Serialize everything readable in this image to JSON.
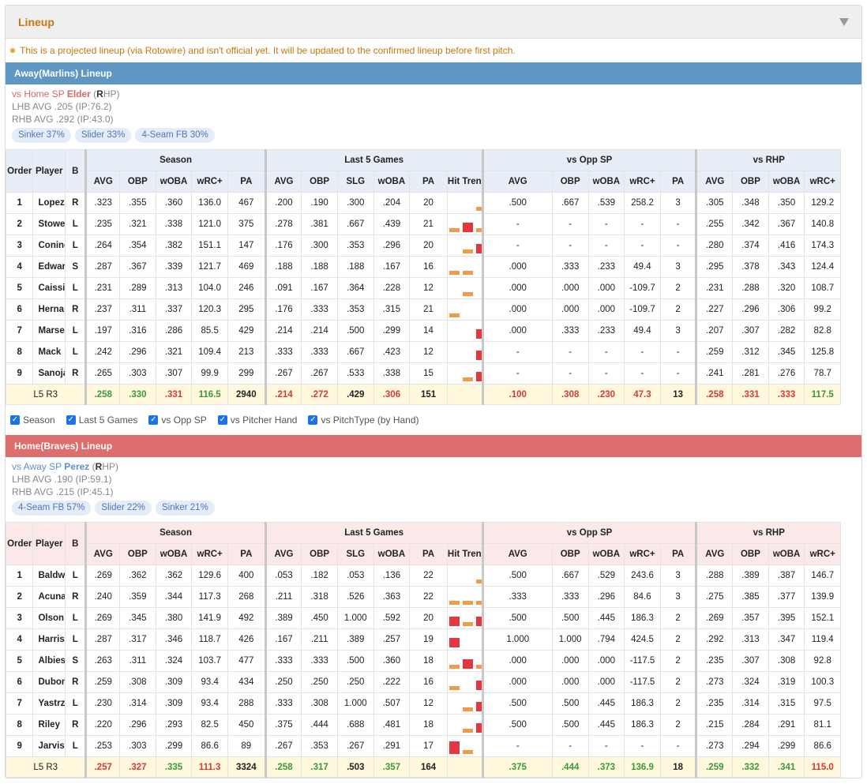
{
  "panel": {
    "title": "Lineup"
  },
  "note": "This is a projected lineup (via Rotowire) and isn't official yet. It will be updated to the confirmed lineup before first pitch.",
  "colors": {
    "away": "#5f97c4",
    "home": "#de6e6e",
    "green": "#3a9a3a",
    "red": "#d43a3a",
    "trend_orange": "#ee9c46",
    "trend_red": "#e3373f"
  },
  "headers": {
    "groups": [
      "Season",
      "Last 5 Games",
      "vs Opp SP",
      "vs RHP"
    ],
    "order": "Order",
    "player": "Player",
    "bats": "B",
    "season": [
      "AVG",
      "OBP",
      "wOBA",
      "wRC+",
      "PA"
    ],
    "last5": [
      "AVG",
      "OBP",
      "SLG",
      "wOBA",
      "PA",
      "Hit Trend"
    ],
    "opp": [
      "AVG",
      "OBP",
      "wOBA",
      "wRC+",
      "PA"
    ],
    "hand": [
      "AVG",
      "OBP",
      "wOBA",
      "wRC+"
    ]
  },
  "toggles": [
    "Season",
    "Last 5 Games",
    "vs Opp SP",
    "vs Pitcher Hand",
    "vs PitchType (by Hand)"
  ],
  "away": {
    "title": "Away(Marlins) Lineup",
    "sp": {
      "prefix": "vs Home SP",
      "name": "Elder",
      "hand_letter": "R",
      "hand_rest": "HP)",
      "hand_open": "("
    },
    "lhb": "LHB AVG .205 (IP:76.2)",
    "rhb": "RHB AVG .292 (IP:43.0)",
    "pitches": [
      "Sinker 37%",
      "Slider 33%",
      "4-Seam FB 30%"
    ],
    "rows": [
      {
        "order": "1",
        "name": "Lopez",
        "bats": "R",
        "s": [
          ".323",
          ".355",
          ".360",
          "136.0",
          "467"
        ],
        "l5": [
          ".200",
          ".190",
          ".300",
          ".204",
          "20"
        ],
        "trend": [
          0,
          0,
          0.3,
          0.3,
          0.65
        ],
        "opp": [
          ".500",
          ".667",
          ".539",
          "258.2",
          "3"
        ],
        "hand": [
          ".305",
          ".348",
          ".350",
          "129.2"
        ]
      },
      {
        "order": "2",
        "name": "Stowers",
        "bats": "L",
        "s": [
          ".235",
          ".321",
          ".338",
          "121.0",
          "375"
        ],
        "l5": [
          ".278",
          ".381",
          ".667",
          ".439",
          "21"
        ],
        "trend": [
          0.3,
          0.65,
          0.3,
          0,
          0.3
        ],
        "opp": [
          "-",
          "-",
          "-",
          "-",
          "-"
        ],
        "hand": [
          ".255",
          ".342",
          ".367",
          "140.8"
        ]
      },
      {
        "order": "3",
        "name": "Conine",
        "bats": "L",
        "s": [
          ".264",
          ".354",
          ".382",
          "151.1",
          "147"
        ],
        "l5": [
          ".176",
          ".300",
          ".353",
          ".296",
          "20"
        ],
        "trend": [
          0,
          0.3,
          0.65,
          0,
          0
        ],
        "opp": [
          "-",
          "-",
          "-",
          "-",
          "-"
        ],
        "hand": [
          ".280",
          ".374",
          ".416",
          "174.3"
        ]
      },
      {
        "order": "4",
        "name": "Edwards",
        "bats": "S",
        "s": [
          ".287",
          ".367",
          ".339",
          "121.7",
          "469"
        ],
        "l5": [
          ".188",
          ".188",
          ".188",
          ".167",
          "16"
        ],
        "trend": [
          0.3,
          0.3,
          0,
          0.3,
          0
        ],
        "opp": [
          ".000",
          ".333",
          ".233",
          "49.4",
          "3"
        ],
        "hand": [
          ".295",
          ".378",
          ".343",
          "124.4"
        ]
      },
      {
        "order": "5",
        "name": "Caissie",
        "bats": "L",
        "s": [
          ".231",
          ".289",
          ".313",
          "104.0",
          "246"
        ],
        "l5": [
          ".091",
          ".167",
          ".364",
          ".228",
          "12"
        ],
        "trend": [
          0,
          0.3,
          0,
          0,
          0
        ],
        "opp": [
          ".000",
          ".000",
          ".000",
          "-109.7",
          "2"
        ],
        "hand": [
          ".231",
          ".288",
          ".320",
          "108.7"
        ]
      },
      {
        "order": "6",
        "name": "Hernandez",
        "bats": "R",
        "s": [
          ".237",
          ".311",
          ".337",
          "120.3",
          "295"
        ],
        "l5": [
          ".176",
          ".333",
          ".353",
          ".315",
          "21"
        ],
        "trend": [
          0.3,
          0,
          0,
          0,
          0.65
        ],
        "opp": [
          ".000",
          ".000",
          ".000",
          "-109.7",
          "2"
        ],
        "hand": [
          ".227",
          ".296",
          ".306",
          "99.2"
        ]
      },
      {
        "order": "7",
        "name": "Marsee",
        "bats": "L",
        "s": [
          ".197",
          ".316",
          ".286",
          "85.5",
          "429"
        ],
        "l5": [
          ".214",
          ".214",
          ".500",
          ".299",
          "14"
        ],
        "trend": [
          0,
          0,
          0.65,
          0,
          0
        ],
        "opp": [
          ".000",
          ".333",
          ".233",
          "49.4",
          "3"
        ],
        "hand": [
          ".207",
          ".307",
          ".282",
          "82.8"
        ]
      },
      {
        "order": "8",
        "name": "Mack",
        "bats": "L",
        "s": [
          ".242",
          ".296",
          ".321",
          "109.4",
          "213"
        ],
        "l5": [
          ".333",
          ".333",
          ".667",
          ".423",
          "12"
        ],
        "trend": [
          0,
          0,
          0.65,
          0.65,
          0
        ],
        "opp": [
          "-",
          "-",
          "-",
          "-",
          "-"
        ],
        "hand": [
          ".259",
          ".312",
          ".345",
          "125.8"
        ]
      },
      {
        "order": "9",
        "name": "Sanoja",
        "bats": "R",
        "s": [
          ".265",
          ".303",
          ".307",
          "99.9",
          "299"
        ],
        "l5": [
          ".267",
          ".267",
          ".533",
          ".338",
          "15"
        ],
        "trend": [
          0,
          0.3,
          0.65,
          0,
          0.3
        ],
        "opp": [
          "-",
          "-",
          "-",
          "-",
          "-"
        ],
        "hand": [
          ".241",
          ".281",
          ".276",
          "78.7"
        ]
      }
    ],
    "total": {
      "label": "L5 R3",
      "s": [
        {
          "v": ".258",
          "c": "g"
        },
        {
          "v": ".330",
          "c": "g"
        },
        {
          "v": ".331",
          "c": "r"
        },
        {
          "v": "116.5",
          "c": "g"
        },
        {
          "v": "2940",
          "c": "k"
        }
      ],
      "l5": [
        {
          "v": ".214",
          "c": "r"
        },
        {
          "v": ".272",
          "c": "r"
        },
        {
          "v": ".429",
          "c": "k"
        },
        {
          "v": ".306",
          "c": "r"
        },
        {
          "v": "151",
          "c": "k"
        }
      ],
      "opp": [
        {
          "v": ".100",
          "c": "r"
        },
        {
          "v": ".308",
          "c": "r"
        },
        {
          "v": ".230",
          "c": "r"
        },
        {
          "v": "47.3",
          "c": "r"
        },
        {
          "v": "13",
          "c": "k"
        }
      ],
      "hand": [
        {
          "v": ".258",
          "c": "r"
        },
        {
          "v": ".331",
          "c": "r"
        },
        {
          "v": ".333",
          "c": "r"
        },
        {
          "v": "117.5",
          "c": "g"
        }
      ]
    }
  },
  "home": {
    "title": "Home(Braves) Lineup",
    "sp": {
      "prefix": "vs Away SP",
      "name": "Perez",
      "hand_letter": "R",
      "hand_rest": "HP)",
      "hand_open": "("
    },
    "lhb": "LHB AVG .190 (IP:59.1)",
    "rhb": "RHB AVG .215 (IP:45.1)",
    "pitches": [
      "4-Seam FB 57%",
      "Slider 22%",
      "Sinker 21%"
    ],
    "rows": [
      {
        "order": "1",
        "name": "Baldwin",
        "bats": "L",
        "s": [
          ".269",
          ".362",
          ".362",
          "129.6",
          "400"
        ],
        "l5": [
          ".053",
          ".182",
          ".053",
          ".136",
          "22"
        ],
        "trend": [
          0,
          0,
          0.3,
          0,
          0
        ],
        "opp": [
          ".500",
          ".667",
          ".529",
          "243.6",
          "3"
        ],
        "hand": [
          ".288",
          ".389",
          ".387",
          "146.7"
        ]
      },
      {
        "order": "2",
        "name": "Acuna Jr.",
        "bats": "R",
        "s": [
          ".240",
          ".359",
          ".344",
          "117.3",
          "268"
        ],
        "l5": [
          ".211",
          ".318",
          ".526",
          ".363",
          "22"
        ],
        "trend": [
          0.3,
          0.3,
          0.3,
          0.3,
          0.3
        ],
        "opp": [
          ".333",
          ".333",
          ".296",
          "84.6",
          "3"
        ],
        "hand": [
          ".275",
          ".385",
          ".377",
          "139.9"
        ]
      },
      {
        "order": "3",
        "name": "Olson",
        "bats": "L",
        "s": [
          ".269",
          ".345",
          ".380",
          "141.9",
          "492"
        ],
        "l5": [
          ".389",
          ".450",
          "1.000",
          ".592",
          "20"
        ],
        "trend": [
          0.65,
          0.3,
          0.65,
          0.65,
          0.65
        ],
        "opp": [
          ".500",
          ".500",
          ".445",
          "186.3",
          "2"
        ],
        "hand": [
          ".269",
          ".357",
          ".395",
          "152.1"
        ]
      },
      {
        "order": "4",
        "name": "Harris",
        "bats": "L",
        "s": [
          ".287",
          ".317",
          ".346",
          "118.7",
          "426"
        ],
        "l5": [
          ".167",
          ".211",
          ".389",
          ".257",
          "19"
        ],
        "trend": [
          0.65,
          0,
          0,
          0,
          0
        ],
        "opp": [
          "1.000",
          "1.000",
          ".794",
          "424.5",
          "2"
        ],
        "hand": [
          ".292",
          ".313",
          ".347",
          "119.4"
        ]
      },
      {
        "order": "5",
        "name": "Albies",
        "bats": "S",
        "s": [
          ".263",
          ".311",
          ".324",
          "103.7",
          "477"
        ],
        "l5": [
          ".333",
          ".333",
          ".500",
          ".360",
          "18"
        ],
        "trend": [
          0.3,
          0.65,
          0.3,
          0.3,
          0.3
        ],
        "opp": [
          ".000",
          ".000",
          ".000",
          "-117.5",
          "2"
        ],
        "hand": [
          ".235",
          ".307",
          ".308",
          "92.8"
        ]
      },
      {
        "order": "6",
        "name": "Dubon",
        "bats": "R",
        "s": [
          ".259",
          ".308",
          ".309",
          "93.4",
          "434"
        ],
        "l5": [
          ".250",
          ".250",
          ".250",
          ".222",
          "16"
        ],
        "trend": [
          0.3,
          0,
          0.65,
          0.3,
          0
        ],
        "opp": [
          ".000",
          ".000",
          ".000",
          "-117.5",
          "2"
        ],
        "hand": [
          ".273",
          ".324",
          ".319",
          "100.3"
        ]
      },
      {
        "order": "7",
        "name": "Yastrzemski",
        "bats": "L",
        "s": [
          ".230",
          ".314",
          ".309",
          "93.4",
          "288"
        ],
        "l5": [
          ".333",
          ".308",
          "1.000",
          ".507",
          "12"
        ],
        "trend": [
          0,
          0.3,
          0.65,
          0.3,
          0
        ],
        "opp": [
          ".500",
          ".500",
          ".445",
          "186.3",
          "2"
        ],
        "hand": [
          ".235",
          ".314",
          ".315",
          "97.5"
        ]
      },
      {
        "order": "8",
        "name": "Riley",
        "bats": "R",
        "s": [
          ".220",
          ".296",
          ".293",
          "82.5",
          "450"
        ],
        "l5": [
          ".375",
          ".444",
          ".688",
          ".481",
          "18"
        ],
        "trend": [
          0,
          0.3,
          0.65,
          0.3,
          0.65
        ],
        "opp": [
          ".500",
          ".500",
          ".445",
          "186.3",
          "2"
        ],
        "hand": [
          ".215",
          ".284",
          ".291",
          "81.1"
        ]
      },
      {
        "order": "9",
        "name": "Jarvis",
        "bats": "L",
        "s": [
          ".253",
          ".303",
          ".299",
          "86.6",
          "89"
        ],
        "l5": [
          ".267",
          ".353",
          ".267",
          ".291",
          "17"
        ],
        "trend": [
          0.9,
          0.3,
          0,
          0,
          0
        ],
        "opp": [
          "-",
          "-",
          "-",
          "-",
          "-"
        ],
        "hand": [
          ".273",
          ".294",
          ".299",
          "86.6"
        ]
      }
    ],
    "total": {
      "label": "L5 R3",
      "s": [
        {
          "v": ".257",
          "c": "r"
        },
        {
          "v": ".327",
          "c": "r"
        },
        {
          "v": ".335",
          "c": "g"
        },
        {
          "v": "111.3",
          "c": "r"
        },
        {
          "v": "3324",
          "c": "k"
        }
      ],
      "l5": [
        {
          "v": ".258",
          "c": "g"
        },
        {
          "v": ".317",
          "c": "g"
        },
        {
          "v": ".503",
          "c": "k"
        },
        {
          "v": ".357",
          "c": "g"
        },
        {
          "v": "164",
          "c": "k"
        }
      ],
      "opp": [
        {
          "v": ".375",
          "c": "g"
        },
        {
          "v": ".444",
          "c": "g"
        },
        {
          "v": ".373",
          "c": "g"
        },
        {
          "v": "136.9",
          "c": "g"
        },
        {
          "v": "18",
          "c": "k"
        }
      ],
      "hand": [
        {
          "v": ".259",
          "c": "g"
        },
        {
          "v": ".332",
          "c": "g"
        },
        {
          "v": ".341",
          "c": "g"
        },
        {
          "v": "115.0",
          "c": "r"
        }
      ]
    }
  }
}
